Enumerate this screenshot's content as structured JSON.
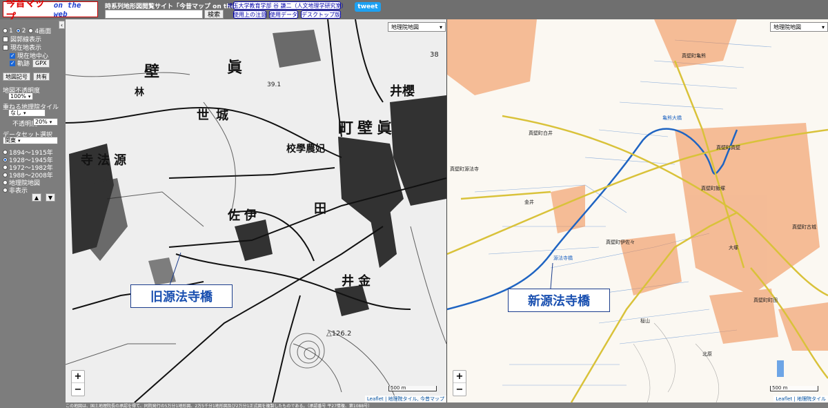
{
  "header": {
    "logo_main": "今昔マップ",
    "logo_sub": "on the web",
    "site_title": "時系列地形図閲覧サイト「今昔マップ on the web」",
    "search_placeholder": "",
    "search_label": "検索",
    "links": [
      "埼玉大学教育学部 谷 謙二（人文地理学研究室）",
      "使用上の注意",
      "使用データ",
      "デスクトップ版"
    ],
    "tweet_label": "tweet"
  },
  "sidebar": {
    "collapse_icon": "‹",
    "screen_options": [
      {
        "label": "1",
        "selected": false
      },
      {
        "label": "2",
        "selected": true
      },
      {
        "label": "4画面",
        "selected": false
      }
    ],
    "checkboxes": [
      {
        "label": "図郭線表示",
        "checked": false
      },
      {
        "label": "現在地表示",
        "checked": false
      },
      {
        "label": "現在地中心",
        "checked": true
      },
      {
        "label": "軌跡",
        "checked": true
      }
    ],
    "gpx_label": "GPX",
    "map_symbols_label": "地図記号",
    "share_label": "共有",
    "opacity_label": "地図不透明度",
    "opacity_value": "100%",
    "overlay_tile_label": "重ねる地理院タイル",
    "overlay_tile_value": "なし",
    "overlay_opacity_label": "不透明度",
    "overlay_opacity_value": "20%",
    "dataset_label": "データセット選択",
    "dataset_value": "関東",
    "periods": [
      {
        "label": "1894～1915年",
        "selected": false
      },
      {
        "label": "1928～1945年",
        "selected": true
      },
      {
        "label": "1972～1982年",
        "selected": false
      },
      {
        "label": "1988～2008年",
        "selected": false
      },
      {
        "label": "地理院地図",
        "selected": false
      },
      {
        "label": "非表示",
        "selected": false
      }
    ],
    "up_icon": "▲",
    "down_icon": "▼"
  },
  "map_old": {
    "layer_select": "地理院地図",
    "callout": "旧源法寺橋",
    "labels": [
      "壁",
      "眞",
      "林",
      "町壁眞",
      "井櫻",
      "世城",
      "校學農妃",
      "寺法源",
      "田",
      "佐伊",
      "井金",
      "△126.2",
      "38",
      "39.1"
    ],
    "zoom_in": "+",
    "zoom_out": "−",
    "scale": "500 m",
    "attribution": "Leaflet | 地理院タイル, 今昔マップ"
  },
  "map_new": {
    "layer_select": "地理院地図",
    "callout": "新源法寺橋",
    "labels": [
      "真壁町亀熊",
      "真壁町白井",
      "亀熊大橋",
      "源法寺橋",
      "真壁町真壁",
      "真壁町源法寺",
      "真壁町飯塚",
      "真壁町古城",
      "真壁町町田",
      "真壁町伊佐々",
      "金井",
      "大塚",
      "北原",
      "桜山"
    ],
    "zoom_in": "+",
    "zoom_out": "−",
    "scale": "500 m",
    "attribution": "Leaflet | 地理院タイル"
  },
  "footer": "この地図は、国土地理院長の承認を得て、同院発行の5万分1地形図、2万5千分1地形図及び2万分1正式図を複製したものである。（承認番号 平27情複、第1088号）",
  "colors": {
    "old_map_ink": "#111111",
    "new_map_roads": "#d9c23a",
    "new_map_buildings": "#f08a4b",
    "new_map_river": "#2a7fc9",
    "callout_text": "#1a50b0"
  }
}
